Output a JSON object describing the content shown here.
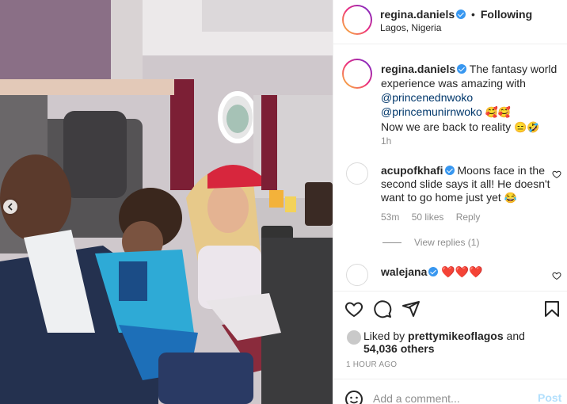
{
  "post": {
    "username": "regina.daniels",
    "follow_status": "Following",
    "location": "Lagos, Nigeria",
    "photo": {
      "description_name": "family-photo-on-airplane"
    }
  },
  "caption": {
    "username": "regina.daniels",
    "text_1": "The fantasy world experience was amazing with",
    "mention_1": "@princenednwoko",
    "mention_2": "@princemunirnwoko",
    "emojis_1": "🥰🥰",
    "text_2": "Now we are back to reality",
    "emojis_2": "😑🤣",
    "time": "1h"
  },
  "comments": [
    {
      "username": "acupofkhafi",
      "text": "Moons face in the second slide says it all! He doesn't want to go home just yet",
      "emoji": "😂",
      "time": "53m",
      "likes": "50 likes",
      "reply_label": "Reply",
      "view_replies": "View replies (1)"
    },
    {
      "username": "walejana",
      "text": "❤️❤️❤️"
    }
  ],
  "likes": {
    "prefix": "Liked by",
    "user": "prettymikeoflagos",
    "and": "and",
    "others": "54,036 others"
  },
  "timestamp": "1 HOUR AGO",
  "add_comment": {
    "placeholder": "Add a comment...",
    "post_label": "Post"
  },
  "colors": {
    "link": "#00376b",
    "verified": "#3897f0",
    "muted": "#8e8e8e",
    "post_disabled": "#b2dffc",
    "heart": "#ed4956"
  },
  "icons": [
    "like-icon",
    "comment-icon",
    "share-icon",
    "save-icon",
    "emoji-icon",
    "verified-badge-icon",
    "chevron-left-icon"
  ]
}
